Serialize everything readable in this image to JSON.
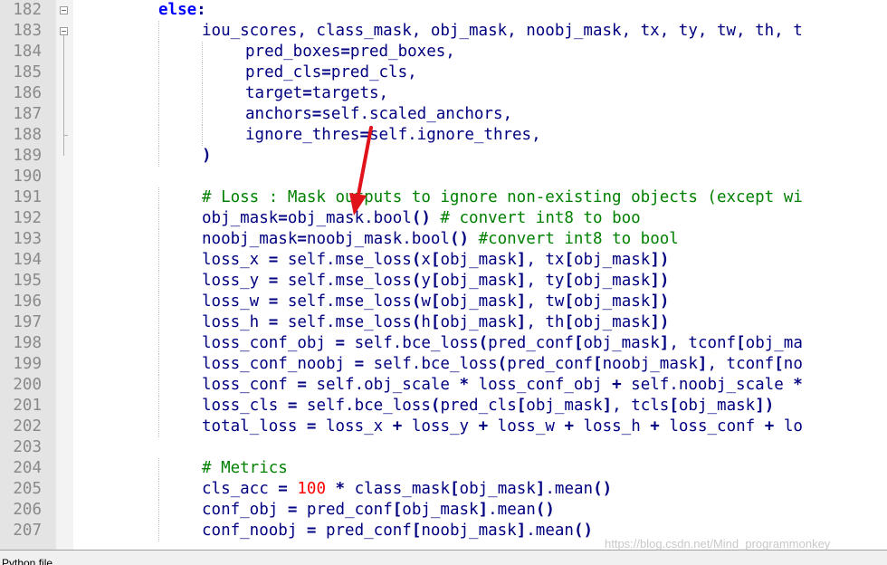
{
  "lines": [
    {
      "num": "182",
      "indent": 2,
      "tokens": [
        {
          "t": "else",
          "c": "kw"
        },
        {
          "t": ":",
          "c": "op"
        }
      ]
    },
    {
      "num": "183",
      "indent": 3,
      "tokens": [
        {
          "t": "iou_scores, class_mask, obj_mask, noobj_mask, tx, ty, tw, th, t",
          "c": "txt"
        }
      ]
    },
    {
      "num": "184",
      "indent": 4,
      "tokens": [
        {
          "t": "pred_boxes",
          "c": "txt"
        },
        {
          "t": "=",
          "c": "op"
        },
        {
          "t": "pred_boxes,",
          "c": "txt"
        }
      ]
    },
    {
      "num": "185",
      "indent": 4,
      "tokens": [
        {
          "t": "pred_cls",
          "c": "txt"
        },
        {
          "t": "=",
          "c": "op"
        },
        {
          "t": "pred_cls,",
          "c": "txt"
        }
      ]
    },
    {
      "num": "186",
      "indent": 4,
      "tokens": [
        {
          "t": "target",
          "c": "txt"
        },
        {
          "t": "=",
          "c": "op"
        },
        {
          "t": "targets,",
          "c": "txt"
        }
      ]
    },
    {
      "num": "187",
      "indent": 4,
      "tokens": [
        {
          "t": "anchors",
          "c": "txt"
        },
        {
          "t": "=",
          "c": "op"
        },
        {
          "t": "self.scaled_anchors,",
          "c": "txt"
        }
      ]
    },
    {
      "num": "188",
      "indent": 4,
      "tokens": [
        {
          "t": "ignore_thres",
          "c": "txt"
        },
        {
          "t": "=",
          "c": "op"
        },
        {
          "t": "self.ignore_thres,",
          "c": "txt"
        }
      ]
    },
    {
      "num": "189",
      "indent": 3,
      "tokens": [
        {
          "t": ")",
          "c": "op"
        }
      ]
    },
    {
      "num": "190",
      "indent": 0,
      "tokens": []
    },
    {
      "num": "191",
      "indent": 3,
      "tokens": [
        {
          "t": "# Loss : Mask outputs to ignore non-existing objects (except wi",
          "c": "com"
        }
      ]
    },
    {
      "num": "192",
      "indent": 3,
      "tokens": [
        {
          "t": "obj_mask",
          "c": "txt"
        },
        {
          "t": "=",
          "c": "op"
        },
        {
          "t": "obj_mask.bool",
          "c": "txt"
        },
        {
          "t": "()",
          "c": "op"
        },
        {
          "t": " # convert int8 to boo",
          "c": "com"
        }
      ]
    },
    {
      "num": "193",
      "indent": 3,
      "tokens": [
        {
          "t": "noobj_mask",
          "c": "txt"
        },
        {
          "t": "=",
          "c": "op"
        },
        {
          "t": "noobj_mask.bool",
          "c": "txt"
        },
        {
          "t": "()",
          "c": "op"
        },
        {
          "t": " #convert int8 to bool",
          "c": "com"
        }
      ]
    },
    {
      "num": "194",
      "indent": 3,
      "tokens": [
        {
          "t": "loss_x ",
          "c": "txt"
        },
        {
          "t": "=",
          "c": "op"
        },
        {
          "t": " self.mse_loss",
          "c": "txt"
        },
        {
          "t": "(",
          "c": "op"
        },
        {
          "t": "x",
          "c": "txt"
        },
        {
          "t": "[",
          "c": "op"
        },
        {
          "t": "obj_mask",
          "c": "txt"
        },
        {
          "t": "]",
          "c": "op"
        },
        {
          "t": ", tx",
          "c": "txt"
        },
        {
          "t": "[",
          "c": "op"
        },
        {
          "t": "obj_mask",
          "c": "txt"
        },
        {
          "t": "])",
          "c": "op"
        }
      ]
    },
    {
      "num": "195",
      "indent": 3,
      "tokens": [
        {
          "t": "loss_y ",
          "c": "txt"
        },
        {
          "t": "=",
          "c": "op"
        },
        {
          "t": " self.mse_loss",
          "c": "txt"
        },
        {
          "t": "(",
          "c": "op"
        },
        {
          "t": "y",
          "c": "txt"
        },
        {
          "t": "[",
          "c": "op"
        },
        {
          "t": "obj_mask",
          "c": "txt"
        },
        {
          "t": "]",
          "c": "op"
        },
        {
          "t": ", ty",
          "c": "txt"
        },
        {
          "t": "[",
          "c": "op"
        },
        {
          "t": "obj_mask",
          "c": "txt"
        },
        {
          "t": "])",
          "c": "op"
        }
      ]
    },
    {
      "num": "196",
      "indent": 3,
      "tokens": [
        {
          "t": "loss_w ",
          "c": "txt"
        },
        {
          "t": "=",
          "c": "op"
        },
        {
          "t": " self.mse_loss",
          "c": "txt"
        },
        {
          "t": "(",
          "c": "op"
        },
        {
          "t": "w",
          "c": "txt"
        },
        {
          "t": "[",
          "c": "op"
        },
        {
          "t": "obj_mask",
          "c": "txt"
        },
        {
          "t": "]",
          "c": "op"
        },
        {
          "t": ", tw",
          "c": "txt"
        },
        {
          "t": "[",
          "c": "op"
        },
        {
          "t": "obj_mask",
          "c": "txt"
        },
        {
          "t": "])",
          "c": "op"
        }
      ]
    },
    {
      "num": "197",
      "indent": 3,
      "tokens": [
        {
          "t": "loss_h ",
          "c": "txt"
        },
        {
          "t": "=",
          "c": "op"
        },
        {
          "t": " self.mse_loss",
          "c": "txt"
        },
        {
          "t": "(",
          "c": "op"
        },
        {
          "t": "h",
          "c": "txt"
        },
        {
          "t": "[",
          "c": "op"
        },
        {
          "t": "obj_mask",
          "c": "txt"
        },
        {
          "t": "]",
          "c": "op"
        },
        {
          "t": ", th",
          "c": "txt"
        },
        {
          "t": "[",
          "c": "op"
        },
        {
          "t": "obj_mask",
          "c": "txt"
        },
        {
          "t": "])",
          "c": "op"
        }
      ]
    },
    {
      "num": "198",
      "indent": 3,
      "tokens": [
        {
          "t": "loss_conf_obj ",
          "c": "txt"
        },
        {
          "t": "=",
          "c": "op"
        },
        {
          "t": " self.bce_loss",
          "c": "txt"
        },
        {
          "t": "(",
          "c": "op"
        },
        {
          "t": "pred_conf",
          "c": "txt"
        },
        {
          "t": "[",
          "c": "op"
        },
        {
          "t": "obj_mask",
          "c": "txt"
        },
        {
          "t": "]",
          "c": "op"
        },
        {
          "t": ", tconf",
          "c": "txt"
        },
        {
          "t": "[",
          "c": "op"
        },
        {
          "t": "obj_ma",
          "c": "txt"
        }
      ]
    },
    {
      "num": "199",
      "indent": 3,
      "tokens": [
        {
          "t": "loss_conf_noobj ",
          "c": "txt"
        },
        {
          "t": "=",
          "c": "op"
        },
        {
          "t": " self.bce_loss",
          "c": "txt"
        },
        {
          "t": "(",
          "c": "op"
        },
        {
          "t": "pred_conf",
          "c": "txt"
        },
        {
          "t": "[",
          "c": "op"
        },
        {
          "t": "noobj_mask",
          "c": "txt"
        },
        {
          "t": "]",
          "c": "op"
        },
        {
          "t": ", tconf",
          "c": "txt"
        },
        {
          "t": "[",
          "c": "op"
        },
        {
          "t": "no",
          "c": "txt"
        }
      ]
    },
    {
      "num": "200",
      "indent": 3,
      "tokens": [
        {
          "t": "loss_conf ",
          "c": "txt"
        },
        {
          "t": "=",
          "c": "op"
        },
        {
          "t": " self.obj_scale ",
          "c": "txt"
        },
        {
          "t": "*",
          "c": "op"
        },
        {
          "t": " loss_conf_obj ",
          "c": "txt"
        },
        {
          "t": "+",
          "c": "op"
        },
        {
          "t": " self.noobj_scale ",
          "c": "txt"
        },
        {
          "t": "*",
          "c": "op"
        }
      ]
    },
    {
      "num": "201",
      "indent": 3,
      "tokens": [
        {
          "t": "loss_cls ",
          "c": "txt"
        },
        {
          "t": "=",
          "c": "op"
        },
        {
          "t": " self.bce_loss",
          "c": "txt"
        },
        {
          "t": "(",
          "c": "op"
        },
        {
          "t": "pred_cls",
          "c": "txt"
        },
        {
          "t": "[",
          "c": "op"
        },
        {
          "t": "obj_mask",
          "c": "txt"
        },
        {
          "t": "]",
          "c": "op"
        },
        {
          "t": ", tcls",
          "c": "txt"
        },
        {
          "t": "[",
          "c": "op"
        },
        {
          "t": "obj_mask",
          "c": "txt"
        },
        {
          "t": "])",
          "c": "op"
        }
      ]
    },
    {
      "num": "202",
      "indent": 3,
      "tokens": [
        {
          "t": "total_loss ",
          "c": "txt"
        },
        {
          "t": "=",
          "c": "op"
        },
        {
          "t": " loss_x ",
          "c": "txt"
        },
        {
          "t": "+",
          "c": "op"
        },
        {
          "t": " loss_y ",
          "c": "txt"
        },
        {
          "t": "+",
          "c": "op"
        },
        {
          "t": " loss_w ",
          "c": "txt"
        },
        {
          "t": "+",
          "c": "op"
        },
        {
          "t": " loss_h ",
          "c": "txt"
        },
        {
          "t": "+",
          "c": "op"
        },
        {
          "t": " loss_conf ",
          "c": "txt"
        },
        {
          "t": "+",
          "c": "op"
        },
        {
          "t": " lo",
          "c": "txt"
        }
      ]
    },
    {
      "num": "203",
      "indent": 0,
      "tokens": []
    },
    {
      "num": "204",
      "indent": 3,
      "tokens": [
        {
          "t": "# Metrics",
          "c": "com"
        }
      ]
    },
    {
      "num": "205",
      "indent": 3,
      "tokens": [
        {
          "t": "cls_acc ",
          "c": "txt"
        },
        {
          "t": "=",
          "c": "op"
        },
        {
          "t": " ",
          "c": "txt"
        },
        {
          "t": "100",
          "c": "num"
        },
        {
          "t": " ",
          "c": "txt"
        },
        {
          "t": "*",
          "c": "op"
        },
        {
          "t": " class_mask",
          "c": "txt"
        },
        {
          "t": "[",
          "c": "op"
        },
        {
          "t": "obj_mask",
          "c": "txt"
        },
        {
          "t": "]",
          "c": "op"
        },
        {
          "t": ".mean",
          "c": "txt"
        },
        {
          "t": "()",
          "c": "op"
        }
      ]
    },
    {
      "num": "206",
      "indent": 3,
      "tokens": [
        {
          "t": "conf_obj ",
          "c": "txt"
        },
        {
          "t": "=",
          "c": "op"
        },
        {
          "t": " pred_conf",
          "c": "txt"
        },
        {
          "t": "[",
          "c": "op"
        },
        {
          "t": "obj_mask",
          "c": "txt"
        },
        {
          "t": "]",
          "c": "op"
        },
        {
          "t": ".mean",
          "c": "txt"
        },
        {
          "t": "()",
          "c": "op"
        }
      ]
    },
    {
      "num": "207",
      "indent": 3,
      "tokens": [
        {
          "t": "conf_noobj ",
          "c": "txt"
        },
        {
          "t": "=",
          "c": "op"
        },
        {
          "t": " pred_conf",
          "c": "txt"
        },
        {
          "t": "[",
          "c": "op"
        },
        {
          "t": "noobj_mask",
          "c": "txt"
        },
        {
          "t": "]",
          "c": "op"
        },
        {
          "t": ".mean",
          "c": "txt"
        },
        {
          "t": "()",
          "c": "op"
        }
      ]
    }
  ],
  "status_bar": {
    "text": "Python file"
  },
  "watermark": {
    "text": "https://blog.csdn.net/Mind_programmonkey"
  },
  "colors": {
    "keyword": "#0000ff",
    "identifier": "#000080",
    "comment": "#008000",
    "number": "#ff0000",
    "line_number": "#8a8a8a",
    "gutter": "#e4e4e4",
    "annotation_arrow": "#e0121a"
  },
  "annotation": {
    "type": "arrow",
    "color": "#e0121a",
    "points_to": "obj_mask on line 192"
  }
}
